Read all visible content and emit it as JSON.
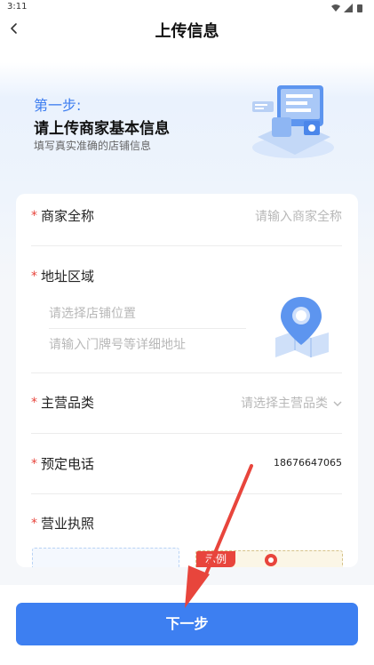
{
  "status_bar": {
    "time": "3:11"
  },
  "nav": {
    "title": "上传信息"
  },
  "hero": {
    "step_label": "第一步:",
    "title": "请上传商家基本信息",
    "subtitle": "填写真实准确的店铺信息"
  },
  "form": {
    "required_mark": "*",
    "merchant_name": {
      "label": "商家全称",
      "placeholder": "请输入商家全称"
    },
    "address": {
      "label": "地址区域",
      "location_placeholder": "请选择店铺位置",
      "detail_placeholder": "请输入门牌号等详细地址"
    },
    "category": {
      "label": "主营品类",
      "placeholder": "请选择主营品类"
    },
    "phone": {
      "label": "预定电话",
      "value": "18676647065"
    },
    "license": {
      "label": "营业执照",
      "example_tag": "示例"
    }
  },
  "footer": {
    "next_label": "下一步"
  },
  "colors": {
    "accent": "#3d7ff1",
    "required": "#e8453c",
    "annotation_arrow": "#e8453c"
  }
}
